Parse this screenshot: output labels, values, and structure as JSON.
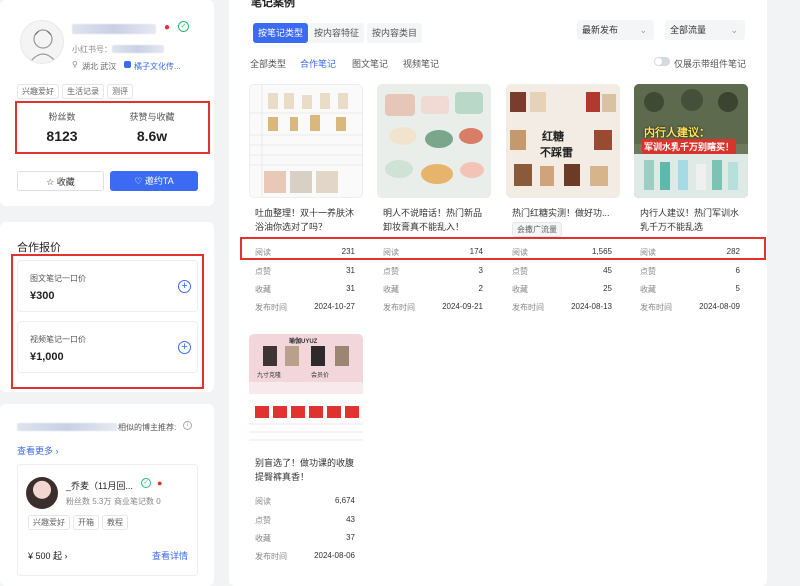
{
  "profile": {
    "redbook_label": "小红书号：",
    "location": "湖北 武汉",
    "company": "橘子文化传...",
    "tags": [
      "兴趣爱好",
      "生活记录",
      "测评"
    ],
    "stats": [
      {
        "label": "粉丝数",
        "value": "8123"
      },
      {
        "label": "获赞与收藏",
        "value": "8.6w"
      }
    ],
    "fav_label": "收藏",
    "invite_label": "邀约TA"
  },
  "pricing": {
    "title": "合作报价",
    "items": [
      {
        "label": "图文笔记一口价",
        "price": "¥300"
      },
      {
        "label": "视频笔记一口价",
        "price": "¥1,000"
      }
    ]
  },
  "recommend": {
    "title_suffix": "相似的博主推荐:",
    "more_label": "查看更多",
    "blogger": {
      "name": "_乔麦（11月回...",
      "fans": "粉丝数 5.3万",
      "notes": "商业笔记数 0",
      "tags": [
        "兴趣爱好",
        "开箱",
        "教程"
      ],
      "price": "¥ 500 起",
      "detail_label": "查看详情"
    }
  },
  "notes_panel": {
    "header": "笔记案例",
    "tabs": [
      "按笔记类型",
      "按内容特征",
      "按内容类目"
    ],
    "sort": "最新发布",
    "traffic": "全部流量",
    "subtabs": [
      "全部类型",
      "合作笔记",
      "图文笔记",
      "视频笔记"
    ],
    "toggle_label": "仅展示带组件笔记",
    "stat_labels": [
      "阅读",
      "点赞",
      "收藏",
      "发布时间"
    ],
    "notes": [
      {
        "title": "吐血整理！双十一养肤沐浴油你选对了吗？",
        "read": "231",
        "like": "31",
        "fav": "31",
        "date": "2024-10-27",
        "tag": ""
      },
      {
        "title": "明人不说暗话！热门新品卸妆膏真不能乱入！",
        "read": "174",
        "like": "3",
        "fav": "2",
        "date": "2024-09-21",
        "tag": ""
      },
      {
        "title": "热门红糖实测！做好功...",
        "read": "1,565",
        "like": "45",
        "fav": "25",
        "date": "2024-08-13",
        "tag": "会撒广流量"
      },
      {
        "title": "内行人建议！热门军训水乳千万不能乱选",
        "read": "282",
        "like": "6",
        "fav": "5",
        "date": "2024-08-09",
        "tag": ""
      },
      {
        "title": "别盲选了！做功课的收腹提臀裤真香！",
        "read": "6,674",
        "like": "43",
        "fav": "37",
        "date": "2024-08-06",
        "tag": ""
      }
    ],
    "thumb_text": {
      "n3": [
        "红糖",
        "不踩雷"
      ],
      "n4": [
        "内行人建议：",
        "军训水乳千万别瞎买！"
      ],
      "n5": [
        "瑜伽UYUZ",
        "九寸克隆",
        "会员价"
      ]
    }
  },
  "colors": {
    "accent": "#3b6bf2",
    "highlight": "#e0322e"
  }
}
